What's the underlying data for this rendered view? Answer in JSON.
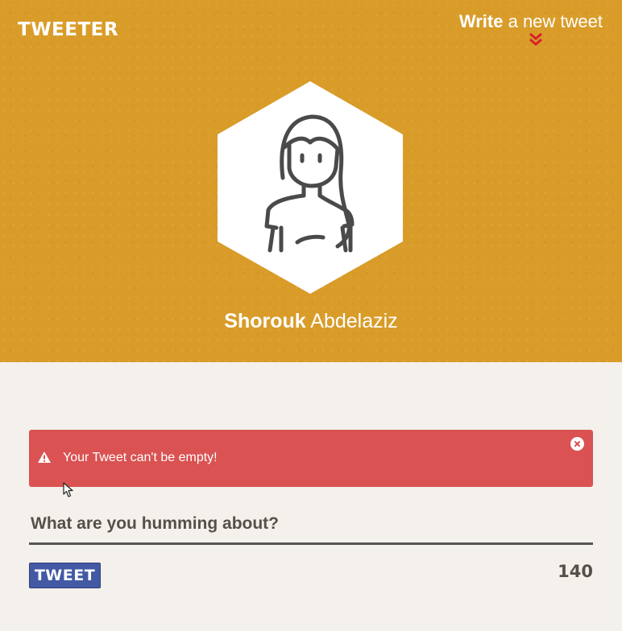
{
  "header": {
    "logo": "TWEETER",
    "write_link": {
      "strong": "Write",
      "rest": "a new tweet"
    },
    "chevron_icon": "double-chevron-down-icon"
  },
  "profile": {
    "avatar_icon": "hexagon-avatar-woman-icon",
    "first_name": "Shorouk",
    "last_name": "Abdelaziz"
  },
  "alert": {
    "message": "Your Tweet can't be empty!",
    "icon": "warning-icon",
    "close_icon": "close-icon"
  },
  "composer": {
    "placeholder": "What are you humming about?",
    "value": "",
    "submit_label": "TWEET",
    "counter": "140"
  },
  "colors": {
    "hero_bg": "#d99c29",
    "page_bg": "#f4f1ec",
    "alert_bg": "#da5252",
    "button_bg": "#4359a3",
    "chevron": "#d6202b",
    "text_dark": "#545149"
  }
}
